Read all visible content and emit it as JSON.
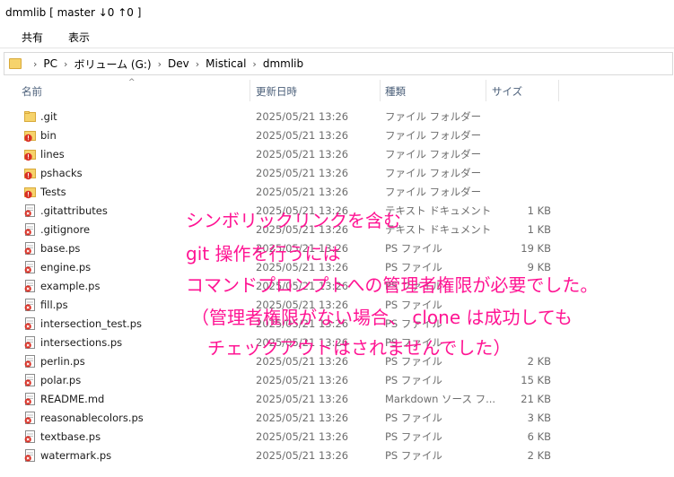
{
  "window": {
    "title": "dmmlib [ master ↓0 ↑0 ]"
  },
  "ribbon": {
    "tabs": [
      "共有",
      "表示"
    ]
  },
  "address": {
    "crumbs": [
      "PC",
      "ボリューム (G:)",
      "Dev",
      "Mistical",
      "dmmlib"
    ]
  },
  "columns": {
    "name": "名前",
    "date": "更新日時",
    "type": "種類",
    "size": "サイズ"
  },
  "colors": {
    "annotation": "#ff1493",
    "folder": "#f6d36b",
    "conflict": "#d93025",
    "modified": "#d93025"
  },
  "files": [
    {
      "name": ".git",
      "date": "2025/05/21 13:26",
      "type": "ファイル フォルダー",
      "size": "",
      "icon": "folder-icon"
    },
    {
      "name": "bin",
      "date": "2025/05/21 13:26",
      "type": "ファイル フォルダー",
      "size": "",
      "icon": "folder-conflict-icon"
    },
    {
      "name": "lines",
      "date": "2025/05/21 13:26",
      "type": "ファイル フォルダー",
      "size": "",
      "icon": "folder-conflict-icon"
    },
    {
      "name": "pshacks",
      "date": "2025/05/21 13:26",
      "type": "ファイル フォルダー",
      "size": "",
      "icon": "folder-conflict-icon"
    },
    {
      "name": "Tests",
      "date": "2025/05/21 13:26",
      "type": "ファイル フォルダー",
      "size": "",
      "icon": "folder-conflict-icon"
    },
    {
      "name": ".gitattributes",
      "date": "2025/05/21 13:26",
      "type": "テキスト ドキュメント",
      "size": "1 KB",
      "icon": "file-modified-icon"
    },
    {
      "name": ".gitignore",
      "date": "2025/05/21 13:26",
      "type": "テキスト ドキュメント",
      "size": "1 KB",
      "icon": "file-modified-icon"
    },
    {
      "name": "base.ps",
      "date": "2025/05/21 13:26",
      "type": "PS ファイル",
      "size": "19 KB",
      "icon": "file-modified-icon"
    },
    {
      "name": "engine.ps",
      "date": "2025/05/21 13:26",
      "type": "PS ファイル",
      "size": "9 KB",
      "icon": "file-modified-icon"
    },
    {
      "name": "example.ps",
      "date": "2025/05/21 13:26",
      "type": "PS ファイル",
      "size": "",
      "icon": "file-modified-icon"
    },
    {
      "name": "fill.ps",
      "date": "2025/05/21 13:26",
      "type": "PS ファイル",
      "size": "",
      "icon": "file-modified-icon"
    },
    {
      "name": "intersection_test.ps",
      "date": "2025/05/21 13:26",
      "type": "PS ファイル",
      "size": "",
      "icon": "file-modified-icon"
    },
    {
      "name": "intersections.ps",
      "date": "2025/05/21 13:26",
      "type": "PS ファイル",
      "size": "",
      "icon": "file-modified-icon"
    },
    {
      "name": "perlin.ps",
      "date": "2025/05/21 13:26",
      "type": "PS ファイル",
      "size": "2 KB",
      "icon": "file-modified-icon"
    },
    {
      "name": "polar.ps",
      "date": "2025/05/21 13:26",
      "type": "PS ファイル",
      "size": "15 KB",
      "icon": "file-modified-icon"
    },
    {
      "name": "README.md",
      "date": "2025/05/21 13:26",
      "type": "Markdown ソース フ...",
      "size": "21 KB",
      "icon": "file-modified-icon"
    },
    {
      "name": "reasonablecolors.ps",
      "date": "2025/05/21 13:26",
      "type": "PS ファイル",
      "size": "3 KB",
      "icon": "file-modified-icon"
    },
    {
      "name": "textbase.ps",
      "date": "2025/05/21 13:26",
      "type": "PS ファイル",
      "size": "6 KB",
      "icon": "file-modified-icon"
    },
    {
      "name": "watermark.ps",
      "date": "2025/05/21 13:26",
      "type": "PS ファイル",
      "size": "2 KB",
      "icon": "file-modified-icon"
    }
  ],
  "annotation": {
    "lines": [
      "シンボリックリンクを含む",
      "git 操作を行うには",
      "コマンドプロンプトへの管理者権限が必要でした。",
      "（管理者権限がない場合、 clone は成功しても",
      "チェックアウトはされませんでした）"
    ]
  }
}
